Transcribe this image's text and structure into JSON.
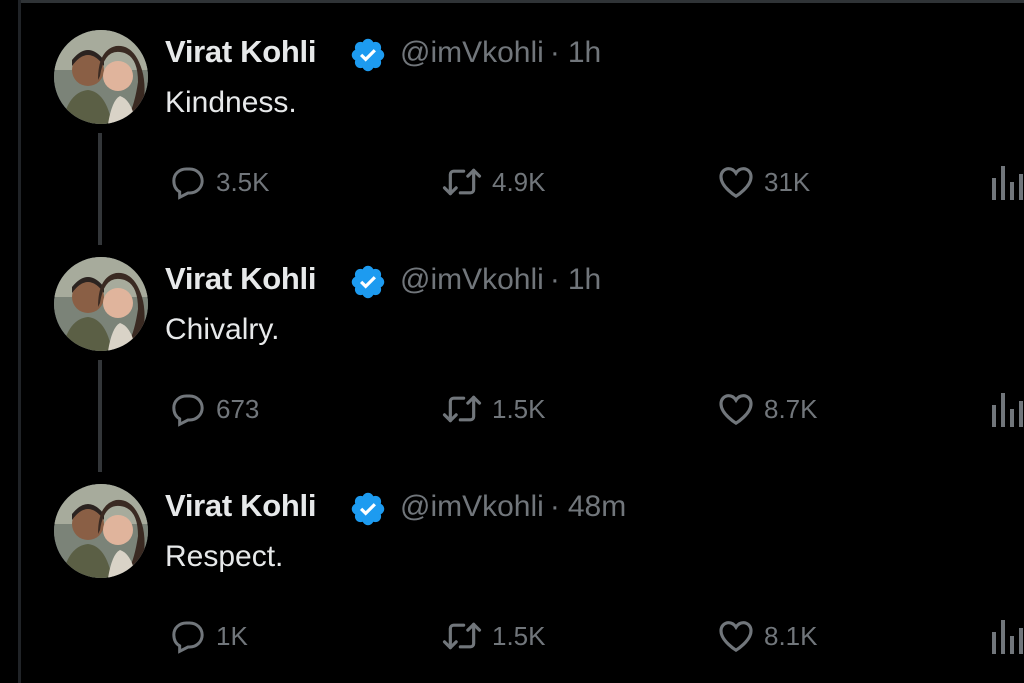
{
  "tweets": [
    {
      "author_name": "Virat Kohli",
      "handle": "@imVkohli",
      "separator": "·",
      "time": "1h",
      "text": "Kindness.",
      "replies": "3.5K",
      "retweets": "4.9K",
      "likes": "31K"
    },
    {
      "author_name": "Virat Kohli",
      "handle": "@imVkohli",
      "separator": "·",
      "time": "1h",
      "text": "Chivalry.",
      "replies": "673",
      "retweets": "1.5K",
      "likes": "8.7K"
    },
    {
      "author_name": "Virat Kohli",
      "handle": "@imVkohli",
      "separator": "·",
      "time": "48m",
      "text": "Respect.",
      "replies": "1K",
      "retweets": "1.5K",
      "likes": "8.1K"
    }
  ],
  "icons": {
    "verified": "verified-badge-icon",
    "reply": "reply-icon",
    "retweet": "retweet-icon",
    "like": "heart-icon",
    "views": "views-chart-icon"
  },
  "colors": {
    "background": "#000000",
    "primary_text": "#e7e9ea",
    "secondary_text": "#71767b",
    "verified": "#1d9bf0",
    "thread_line": "#333639"
  }
}
